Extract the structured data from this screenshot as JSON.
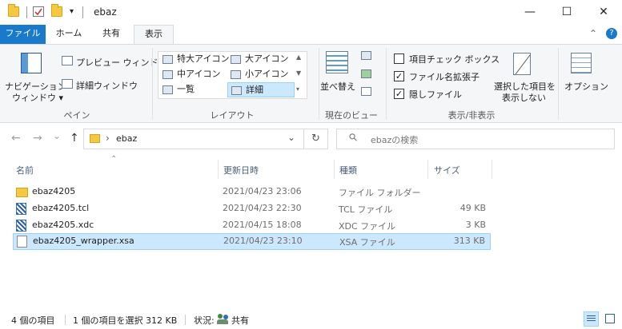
{
  "window": {
    "title": "ebaz",
    "minimize_glyph": "—",
    "maximize_glyph": "☐",
    "close_glyph": "✕"
  },
  "tabs": [
    {
      "label": "ファイル"
    },
    {
      "label": "ホーム"
    },
    {
      "label": "共有"
    },
    {
      "label": "表示"
    }
  ],
  "ribbon": {
    "collapse_glyph": "⌃",
    "help_glyph": "?",
    "pane": {
      "nav_line1": "ナビゲーション",
      "nav_line2": "ウィンドウ ▾",
      "preview": "プレビュー ウィンドウ",
      "details": "詳細ウィンドウ",
      "group": "ペイン"
    },
    "layout": {
      "items": [
        "特大アイコン",
        "大アイコン",
        "中アイコン",
        "小アイコン",
        "一覧",
        "詳細"
      ],
      "group": "レイアウト"
    },
    "current_view": {
      "sort_label": "並べ替え",
      "group": "現在のビュー"
    },
    "show_hide": {
      "item_checkboxes": "項目チェック ボックス",
      "file_extensions": "ファイル名拡張子",
      "hidden_items": "隠しファイル",
      "hide_selected_line1": "選択した項目を",
      "hide_selected_line2": "表示しない",
      "group": "表示/非表示"
    },
    "options": "オプション"
  },
  "address": {
    "back_glyph": "←",
    "forward_glyph": "→",
    "recent_glyph": "⌄",
    "up_glyph": "↑",
    "crumb_sep": "›",
    "path": "ebaz",
    "dropdown_glyph": "⌄",
    "refresh_glyph": "↻",
    "search_glyph": "⚲",
    "search_placeholder": "ebazの検索"
  },
  "columns": {
    "name": "名前",
    "sort_glyph": "⌃",
    "date": "更新日時",
    "type": "種類",
    "size": "サイズ"
  },
  "files": [
    {
      "name": "ebaz4205",
      "date": "2021/04/23 23:06",
      "type": "ファイル フォルダー",
      "size": "",
      "icon": "folder-icon"
    },
    {
      "name": "ebaz4205.tcl",
      "date": "2021/04/23 22:30",
      "type": "TCL ファイル",
      "size": "49 KB",
      "icon": "tcl-file-icon"
    },
    {
      "name": "ebaz4205.xdc",
      "date": "2021/04/15 18:08",
      "type": "XDC ファイル",
      "size": "3 KB",
      "icon": "xdc-file-icon"
    },
    {
      "name": "ebaz4205_wrapper.xsa",
      "date": "2021/04/23 23:10",
      "type": "XSA ファイル",
      "size": "313 KB",
      "icon": "document-icon",
      "selected": true
    }
  ],
  "status": {
    "count": "4 個の項目",
    "selection": "1 個の項目を選択  312 KB",
    "state_label": "状況:",
    "state_value": "共有"
  },
  "colors": {
    "file_tab": "#1979ca",
    "selection_bg": "#cce8ff",
    "selection_border": "#99d1ff",
    "folder": "#f5c842"
  }
}
